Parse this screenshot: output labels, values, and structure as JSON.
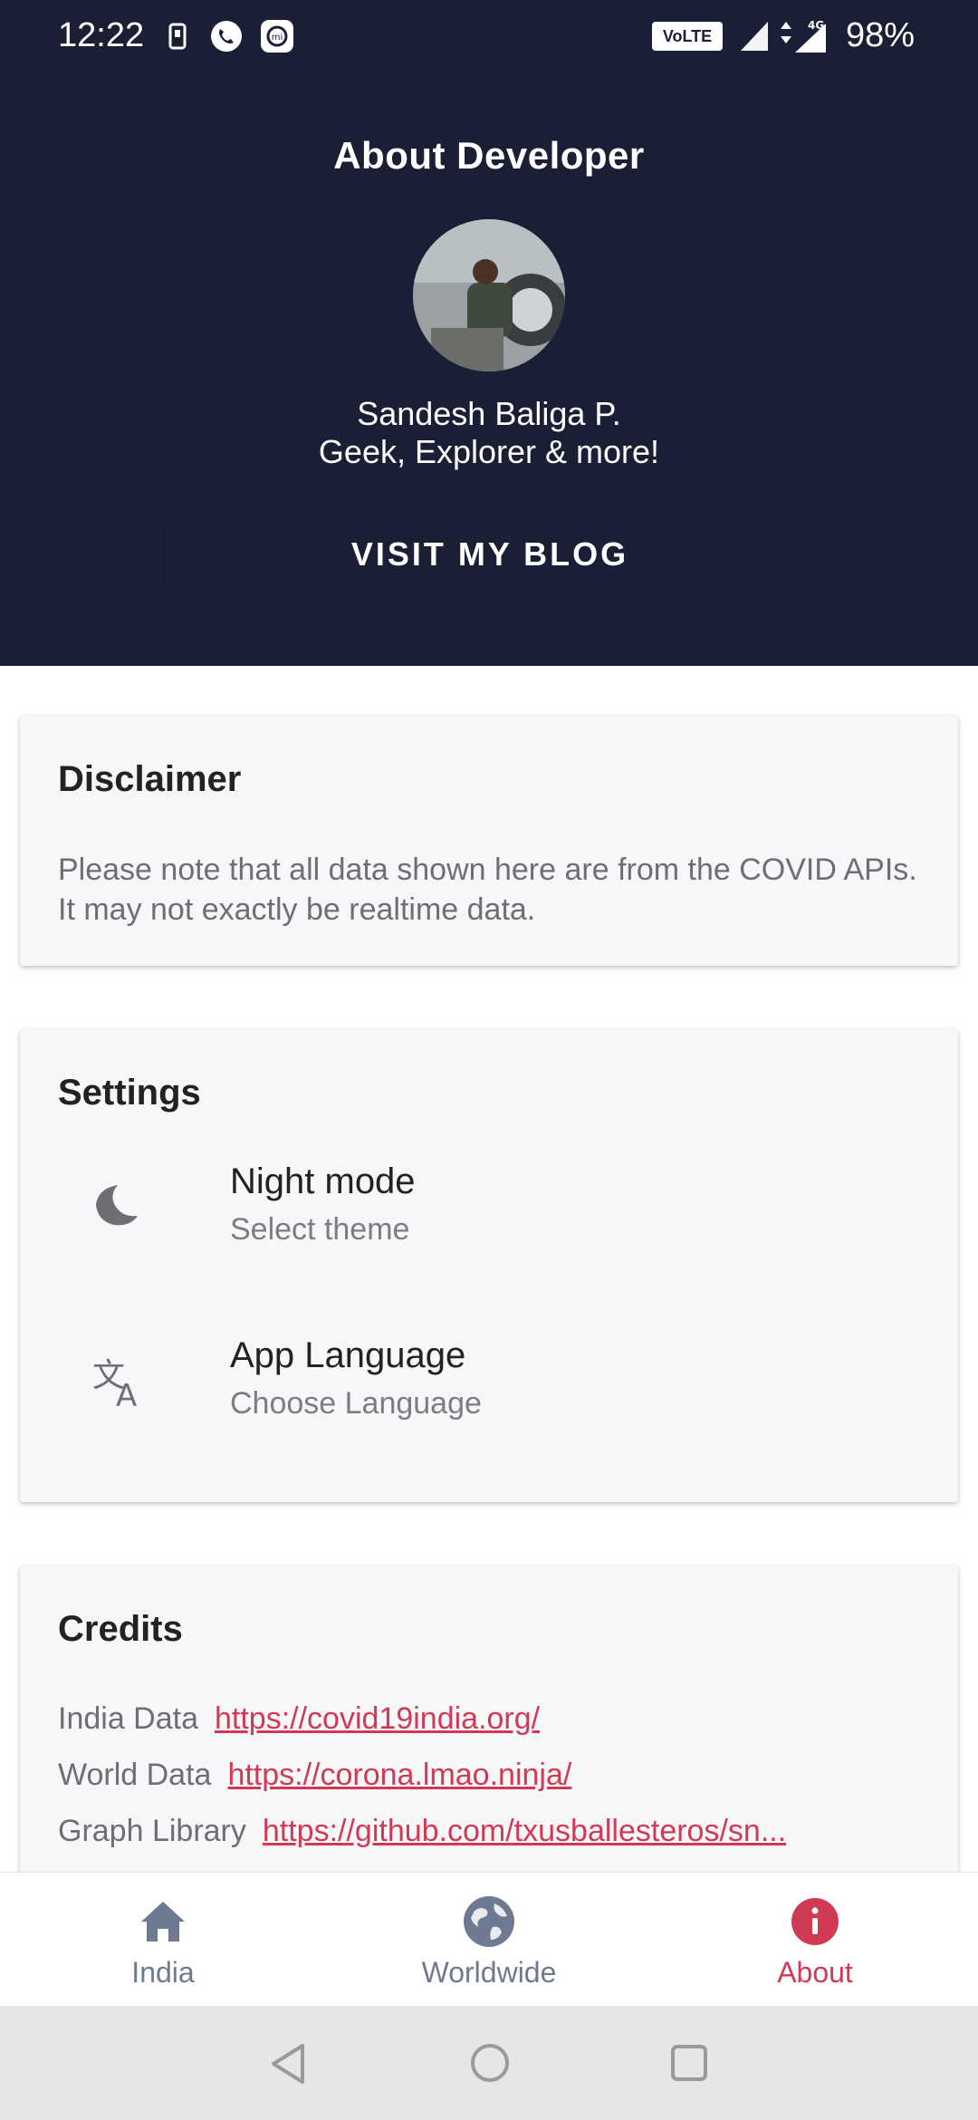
{
  "status_bar": {
    "time": "12:22",
    "battery": "98%",
    "volte": "VoLTE",
    "network": "4G"
  },
  "header": {
    "title": "About Developer",
    "developer_name": "Sandesh Baliga P.",
    "developer_tagline": "Geek, Explorer & more!",
    "blog_button": "VISIT MY BLOG"
  },
  "disclaimer": {
    "title": "Disclaimer",
    "text": "Please note that all data shown here are from the COVID APIs. It may not exactly be realtime data."
  },
  "settings": {
    "title": "Settings",
    "items": [
      {
        "title": "Night mode",
        "subtitle": "Select theme",
        "icon": "night-mode-icon"
      },
      {
        "title": "App Language",
        "subtitle": "Choose Language",
        "icon": "translate-icon"
      }
    ]
  },
  "credits": {
    "title": "Credits",
    "items": [
      {
        "label": "India Data",
        "link": "https://covid19india.org/"
      },
      {
        "label": "World Data",
        "link": "https://corona.lmao.ninja/"
      },
      {
        "label": "Graph Library",
        "link": "https://github.com/txusballesteros/sn..."
      }
    ]
  },
  "bottom_nav": {
    "items": [
      {
        "label": "India",
        "icon": "home-icon"
      },
      {
        "label": "Worldwide",
        "icon": "globe-icon"
      },
      {
        "label": "About",
        "icon": "info-icon",
        "active": true
      }
    ]
  },
  "colors": {
    "header_bg": "#1b1f36",
    "accent": "#d13a55",
    "nav_inactive": "#6e7a91"
  }
}
